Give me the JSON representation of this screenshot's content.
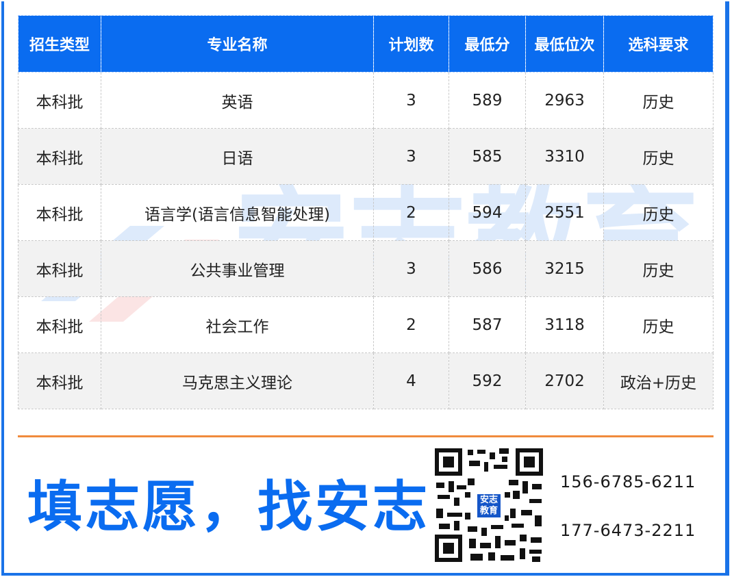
{
  "table": {
    "headers": [
      "招生类型",
      "专业名称",
      "计划数",
      "最低分",
      "最低位次",
      "选科要求"
    ],
    "rows": [
      [
        "本科批",
        "英语",
        "3",
        "589",
        "2963",
        "历史"
      ],
      [
        "本科批",
        "日语",
        "3",
        "585",
        "3310",
        "历史"
      ],
      [
        "本科批",
        "语言学(语言信息智能处理)",
        "2",
        "594",
        "2551",
        "历史"
      ],
      [
        "本科批",
        "公共事业管理",
        "3",
        "586",
        "3215",
        "历史"
      ],
      [
        "本科批",
        "社会工作",
        "2",
        "587",
        "3118",
        "历史"
      ],
      [
        "本科批",
        "马克思主义理论",
        "4",
        "592",
        "2702",
        "政治+历史"
      ]
    ]
  },
  "footer": {
    "slogan": "填志愿，找安志",
    "qr_logo_line1": "安志",
    "qr_logo_line2": "教育",
    "phones": [
      "156-6785-6211",
      "177-6473-2211"
    ]
  },
  "watermark_text": "安志教育",
  "colors": {
    "header_blue": "#0a6cf0",
    "divider_orange": "#f08a3c",
    "alt_row": "#f2f2f2"
  }
}
